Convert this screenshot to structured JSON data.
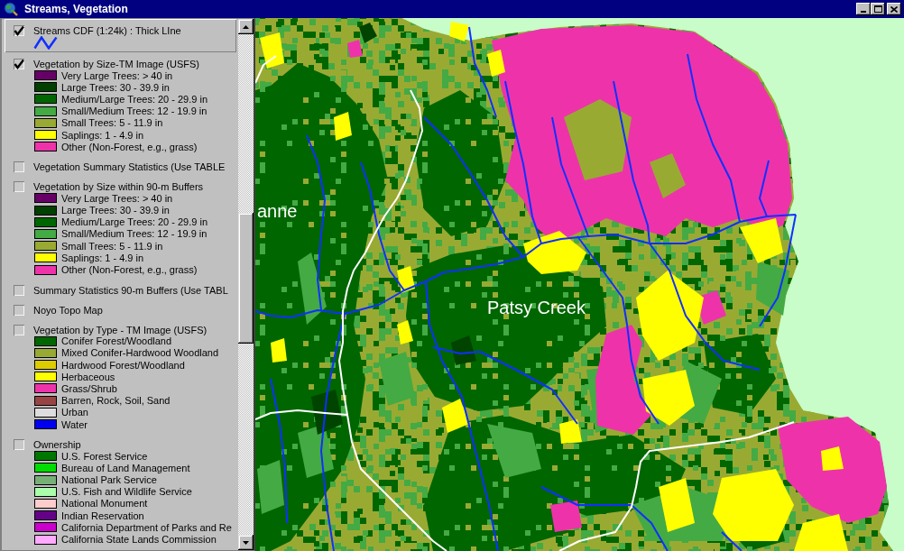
{
  "window": {
    "title": "Streams, Vegetation"
  },
  "legend": {
    "layers": [
      {
        "title": "Streams CDF (1:24k) : Thick LIne",
        "checked": true,
        "selected": true,
        "kind": "line",
        "color": "#1030ff"
      },
      {
        "title": "Vegetation by Size-TM Image (USFS)",
        "checked": true,
        "selected": false,
        "kind": "classes",
        "classes": [
          {
            "label": "Very Large Trees: > 40 in",
            "color": "#660066"
          },
          {
            "label": "Large Trees: 30 - 39.9 in",
            "color": "#004000"
          },
          {
            "label": "Medium/Large Trees: 20 - 29.9 in",
            "color": "#006600"
          },
          {
            "label": "Small/Medium Trees: 12 - 19.9 in",
            "color": "#44aa44"
          },
          {
            "label": "Small Trees: 5 - 11.9 in",
            "color": "#99aa33"
          },
          {
            "label": "Saplings: 1 - 4.9 in",
            "color": "#ffff00"
          },
          {
            "label": "Other (Non-Forest, e.g., grass)",
            "color": "#ee33aa"
          }
        ]
      },
      {
        "title": "Vegetation Summary Statistics (Use TABLE",
        "checked": false,
        "selected": false,
        "kind": "plain"
      },
      {
        "title": "Vegetation by Size within 90-m Buffers",
        "checked": false,
        "selected": false,
        "kind": "classes",
        "classes": [
          {
            "label": "Very Large Trees: > 40 in",
            "color": "#660066"
          },
          {
            "label": "Large Trees: 30 - 39.9 in",
            "color": "#004000"
          },
          {
            "label": "Medium/Large Trees: 20 - 29.9 in",
            "color": "#006600"
          },
          {
            "label": "Small/Medium Trees: 12 - 19.9 in",
            "color": "#44aa44"
          },
          {
            "label": "Small Trees: 5 - 11.9 in",
            "color": "#99aa33"
          },
          {
            "label": "Saplings: 1 - 4.9 in",
            "color": "#ffff00"
          },
          {
            "label": "Other (Non-Forest, e.g., grass)",
            "color": "#ee33aa"
          }
        ]
      },
      {
        "title": "Summary Statistics 90-m Buffers (Use TABL",
        "checked": false,
        "selected": false,
        "kind": "plain"
      },
      {
        "title": "Noyo Topo Map",
        "checked": false,
        "selected": false,
        "kind": "plain"
      },
      {
        "title": "Vegetation by Type - TM Image (USFS)",
        "checked": false,
        "selected": false,
        "kind": "classes",
        "classes": [
          {
            "label": "Conifer Forest/Woodland",
            "color": "#006600"
          },
          {
            "label": "Mixed Conifer-Hardwood Woodland",
            "color": "#99aa33"
          },
          {
            "label": "Hardwood Forest/Woodland",
            "color": "#ddcc00"
          },
          {
            "label": "Herbaceous",
            "color": "#ffff00"
          },
          {
            "label": "Grass/Shrub",
            "color": "#ee33aa"
          },
          {
            "label": "Barren, Rock, Soil, Sand",
            "color": "#994444"
          },
          {
            "label": "Urban",
            "color": "#dddddd"
          },
          {
            "label": "Water",
            "color": "#0000ee"
          }
        ]
      },
      {
        "title": "Ownership",
        "checked": false,
        "selected": false,
        "kind": "classes",
        "classes": [
          {
            "label": "U.S. Forest Service",
            "color": "#007700"
          },
          {
            "label": "Bureau of Land Management",
            "color": "#00dd00"
          },
          {
            "label": "National Park Service",
            "color": "#77b077"
          },
          {
            "label": "U.S. Fish and Wildlife Service",
            "color": "#aaffaa"
          },
          {
            "label": "National Monument",
            "color": "#ffcccc"
          },
          {
            "label": "Indian Reservation",
            "color": "#660088"
          },
          {
            "label": "California Department of Parks and Re",
            "color": "#cc00cc"
          },
          {
            "label": "California State Lands Commission",
            "color": "#ffaaff"
          }
        ]
      }
    ]
  },
  "map": {
    "labels": [
      {
        "text": "anne"
      },
      {
        "text": "Patsy Creek"
      }
    ]
  }
}
